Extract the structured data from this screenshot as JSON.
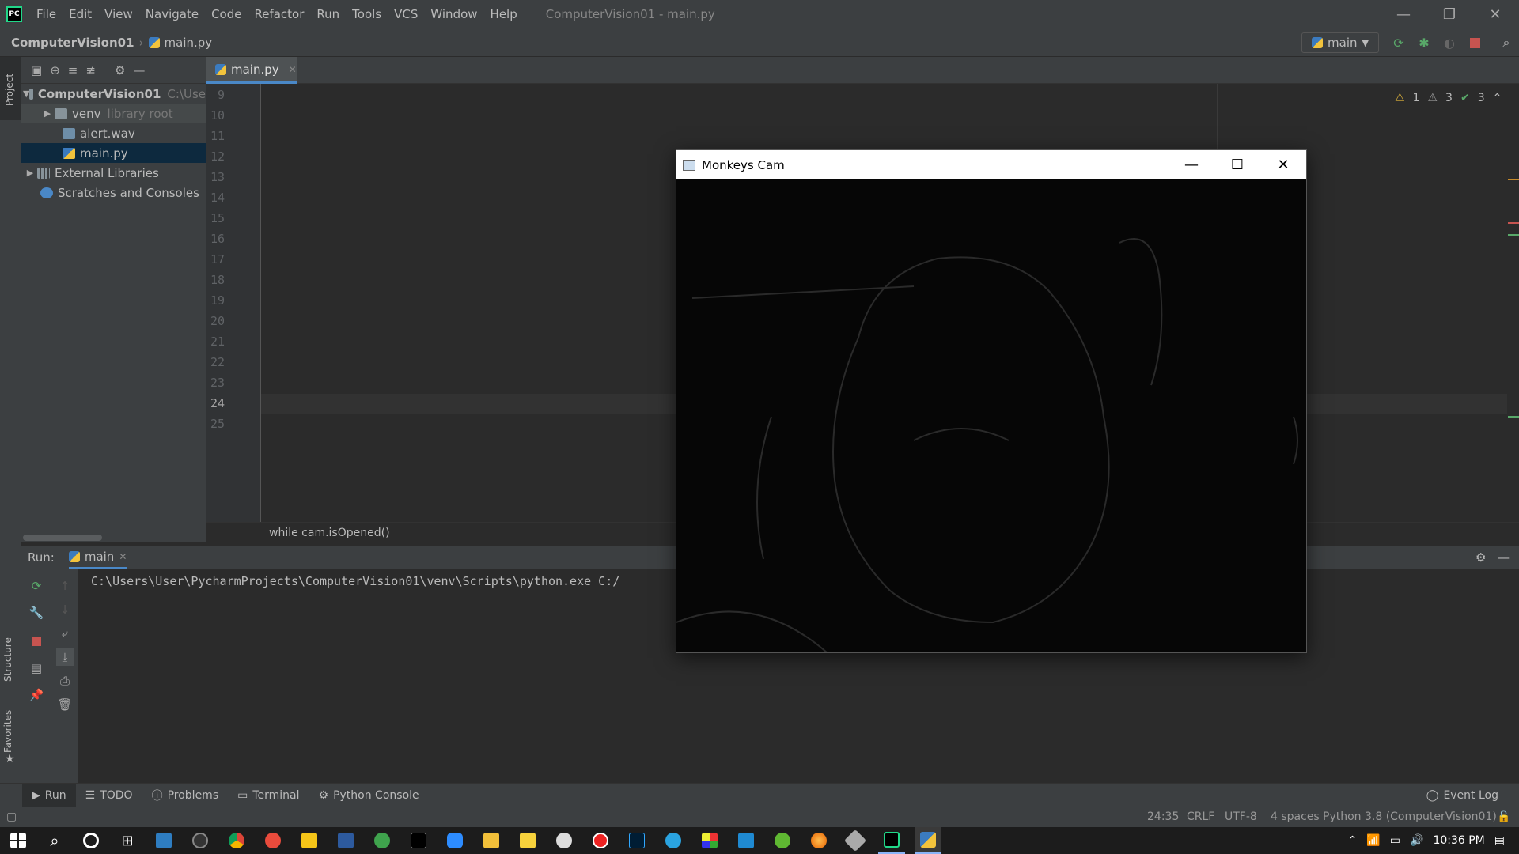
{
  "menubar": {
    "items": [
      "File",
      "Edit",
      "View",
      "Navigate",
      "Code",
      "Refactor",
      "Run",
      "Tools",
      "VCS",
      "Window",
      "Help"
    ],
    "title": "ComputerVision01 - main.py"
  },
  "navbar": {
    "project": "ComputerVision01",
    "file": "main.py",
    "run_config": "main"
  },
  "project_panel": {
    "label": "Project",
    "tree": [
      {
        "label": "ComputerVision01",
        "hint": "C:\\Use"
      },
      {
        "label": "venv",
        "hint": "library root"
      },
      {
        "label": "alert.wav"
      },
      {
        "label": "main.py"
      },
      {
        "label": "External Libraries"
      },
      {
        "label": "Scratches and Consoles"
      }
    ]
  },
  "editor": {
    "tab": "main.py",
    "inspections": {
      "warnings": "1",
      "weak_warnings": "3",
      "ok": "3"
    },
    "line_numbers": [
      "9",
      "10",
      "11",
      "12",
      "13",
      "14",
      "15",
      "16",
      "17",
      "18",
      "19",
      "20",
      "21",
      "22",
      "23",
      "24",
      "25"
    ],
    "breadcrumb": "while cam.isOpened()"
  },
  "run_panel": {
    "label": "Run:",
    "tab": "main",
    "console_line": "C:\\Users\\User\\PycharmProjects\\ComputerVision01\\venv\\Scripts\\python.exe C:/"
  },
  "tool_windows": [
    "Run",
    "TODO",
    "Problems",
    "Terminal",
    "Python Console"
  ],
  "event_log": "Event Log",
  "left_strip": {
    "structure": "Structure",
    "favorites": "Favorites"
  },
  "status": {
    "position": "24:35",
    "line_sep": "CRLF",
    "encoding": "UTF-8",
    "indent": "4 spaces",
    "interpreter": "Python 3.8 (ComputerVision01)"
  },
  "taskbar": {
    "time": "10:36 PM"
  },
  "cam_window": {
    "title": "Monkeys Cam"
  }
}
